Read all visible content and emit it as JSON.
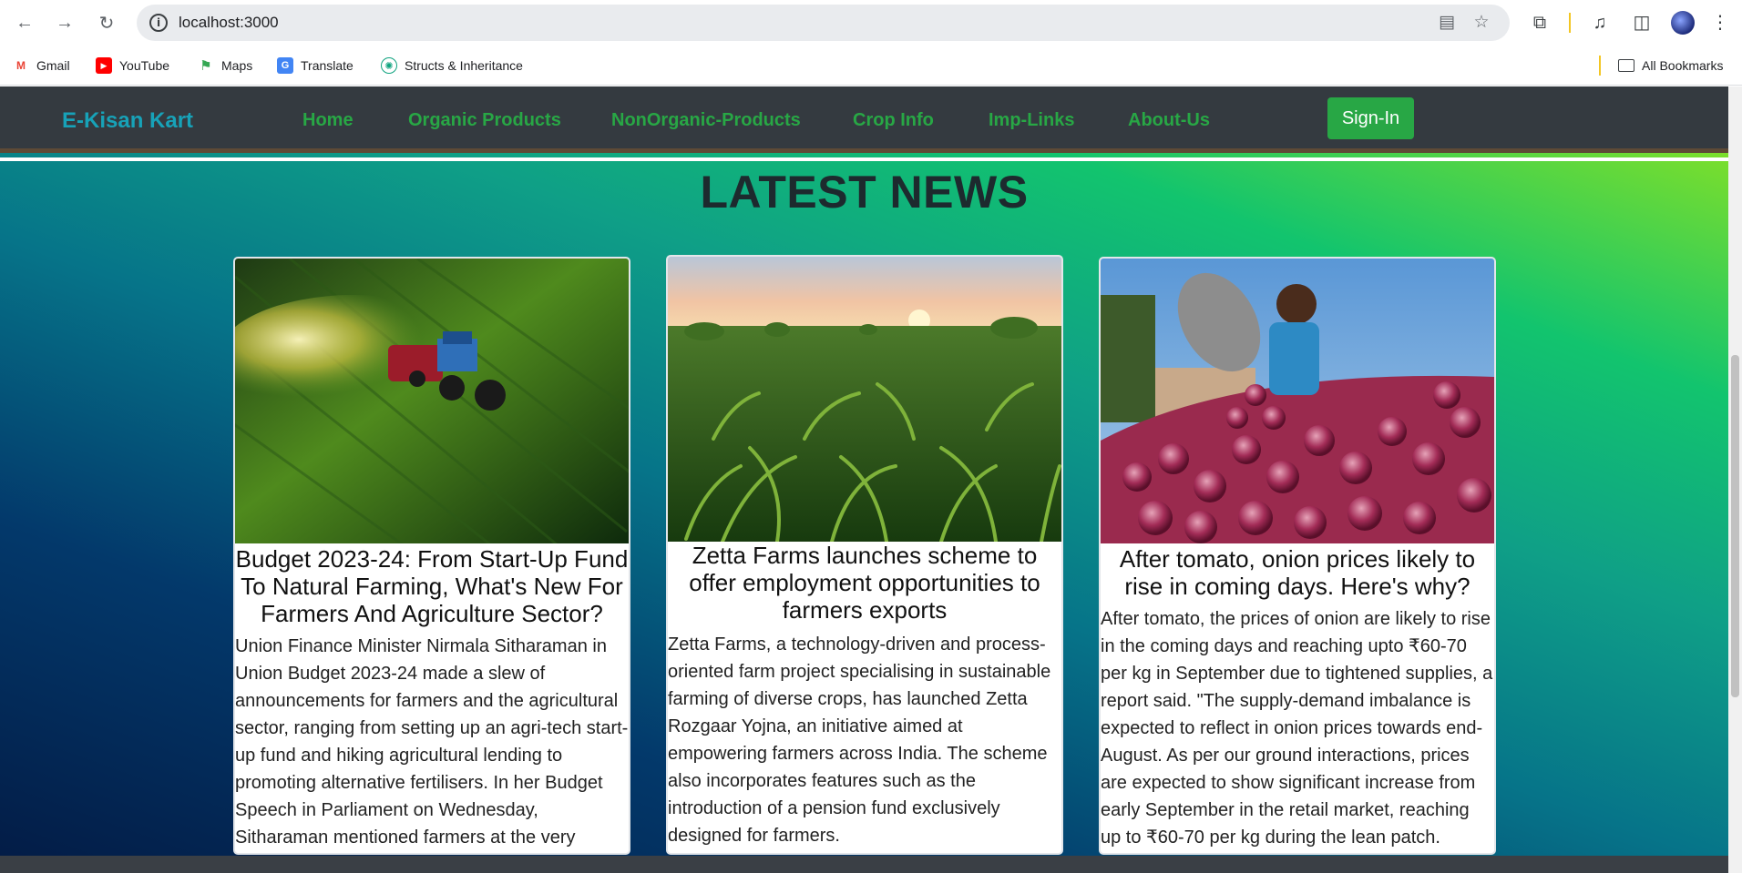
{
  "browser": {
    "url": "localhost:3000",
    "bookmarks": [
      {
        "label": "Gmail",
        "icon": "gmail-icon"
      },
      {
        "label": "YouTube",
        "icon": "youtube-icon"
      },
      {
        "label": "Maps",
        "icon": "maps-icon"
      },
      {
        "label": "Translate",
        "icon": "translate-icon"
      },
      {
        "label": "Structs & Inheritance",
        "icon": "chatgpt-icon"
      }
    ],
    "all_bookmarks": "All Bookmarks"
  },
  "site": {
    "brand": "E-Kisan Kart",
    "nav": [
      "Home",
      "Organic Products",
      "NonOrganic-Products",
      "Crop Info",
      "Imp-Links",
      "About-Us"
    ],
    "signin": "Sign-In",
    "colors": {
      "brand": "#17a2b8",
      "nav": "#28a745",
      "navbar": "#343a40"
    }
  },
  "news": {
    "heading": "LATEST NEWS",
    "cards": [
      {
        "title": "Budget 2023-24: From Start-Up Fund To Natural Farming, What's New For Farmers And Agriculture Sector?",
        "text": "Union Finance Minister Nirmala Sitharaman in Union Budget 2023-24 made a slew of announcements for farmers and the agricultural sector, ranging from setting up an agri-tech start-up fund and hiking agricultural lending to promoting alternative fertilisers. In her Budget Speech in Parliament on Wednesday, Sitharaman mentioned farmers at the very beginning.",
        "image": "tractor-spraying-field-image"
      },
      {
        "title": "Zetta Farms launches scheme to offer employment opportunities to farmers exports",
        "text": "Zetta Farms, a technology-driven and process-oriented farm project specialising in sustainable farming of diverse crops, has launched Zetta Rozgaar Yojna, an initiative aimed at empowering farmers across India. The scheme also incorporates features such as the introduction of a pension fund exclusively designed for farmers.",
        "image": "corn-field-sunset-image"
      },
      {
        "title": "After tomato, onion prices likely to rise in coming days. Here's why?",
        "text": "After tomato, the prices of onion are likely to rise in the coming days and reaching upto ₹60-70 per kg in September due to tightened supplies, a report said. \"The supply-demand imbalance is expected to reflect in onion prices towards end-August. As per our ground interactions, prices are expected to show significant increase from early September in the retail market, reaching up to ₹60-70 per kg during the lean patch.",
        "image": "onion-pile-image"
      }
    ]
  }
}
